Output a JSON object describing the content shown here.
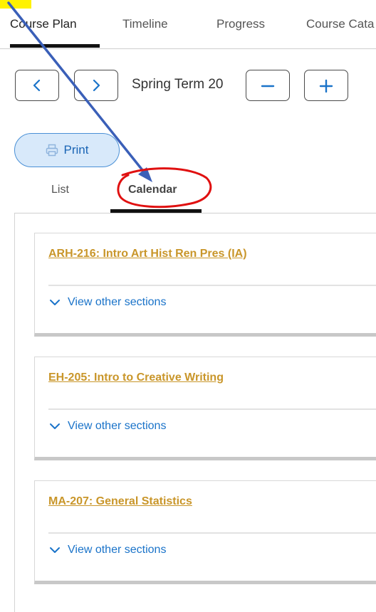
{
  "top_tabs": [
    {
      "label": "Course Plan"
    },
    {
      "label": "Timeline"
    },
    {
      "label": "Progress"
    },
    {
      "label": "Course Cata"
    }
  ],
  "term": {
    "label": "Spring Term 20"
  },
  "print": {
    "label": "Print"
  },
  "view_tabs": [
    {
      "label": "List"
    },
    {
      "label": "Calendar"
    }
  ],
  "courses": [
    {
      "title": "ARH-216: Intro Art Hist Ren Pres (IA)",
      "sections_label": "View other sections"
    },
    {
      "title": "EH-205: Intro to Creative Writing",
      "sections_label": "View other sections"
    },
    {
      "title": "MA-207: General Statistics",
      "sections_label": "View other sections"
    }
  ],
  "colors": {
    "link_blue": "#1a73c9",
    "course_gold": "#c9962a",
    "print_fill": "#d8e9fa",
    "annotation_arrow": "#3a5fb8",
    "annotation_circle": "#e01010",
    "highlight_yellow": "#fff200"
  }
}
